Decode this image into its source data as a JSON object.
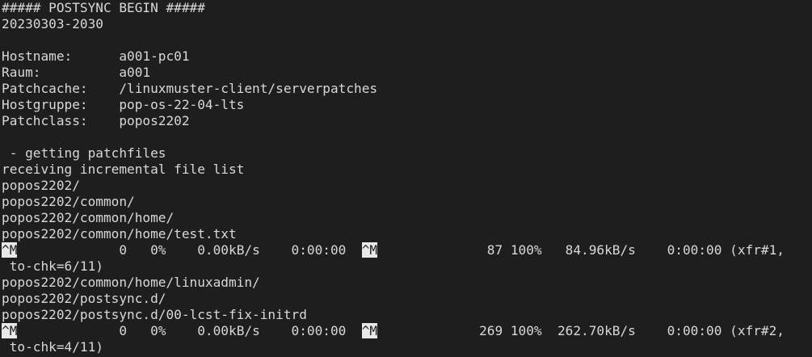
{
  "terminal": {
    "lines": [
      "##### POSTSYNC BEGIN #####",
      "20230303-2030",
      "",
      "Hostname:      a001-pc01",
      "Raum:          a001",
      "Patchcache:    /linuxmuster-client/serverpatches",
      "Hostgruppe:    pop-os-22-04-lts",
      "Patchclass:    popos2202",
      "",
      " - getting patchfiles",
      "receiving incremental file list",
      "popos2202/",
      "popos2202/common/",
      "popos2202/common/home/",
      "popos2202/common/home/test.txt"
    ],
    "progress1": {
      "marker_a": "^M",
      "mid": "             0   0%    0.00kB/s    0:00:00  ",
      "marker_b": "^M",
      "tail": "              87 100%   84.96kB/s    0:00:00 (xfr#1,",
      "wrap": " to-chk=6/11)"
    },
    "lines2": [
      "popos2202/common/home/linuxadmin/",
      "popos2202/postsync.d/",
      "popos2202/postsync.d/00-lcst-fix-initrd"
    ],
    "progress2": {
      "marker_a": "^M",
      "mid": "             0   0%    0.00kB/s    0:00:00  ",
      "marker_b": "^M",
      "tail": "             269 100%  262.70kB/s    0:00:00 (xfr#2,",
      "wrap": " to-chk=4/11)"
    }
  }
}
